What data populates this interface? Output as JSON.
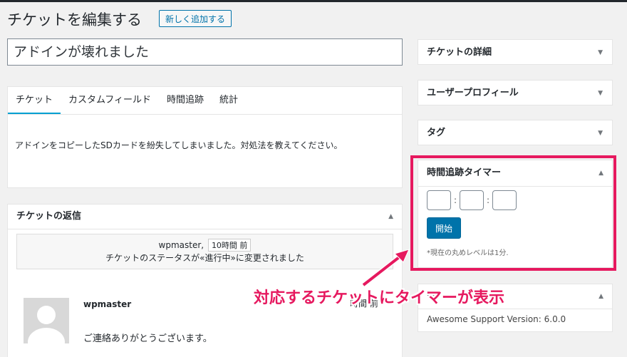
{
  "header": {
    "title": "チケットを編集する",
    "add_new_label": "新しく追加する"
  },
  "ticket": {
    "title_value": "アドインが壊れました"
  },
  "tabs": [
    {
      "label": "チケット",
      "active": true
    },
    {
      "label": "カスタムフィールド"
    },
    {
      "label": "時間追跡"
    },
    {
      "label": "統計"
    }
  ],
  "tab_content": {
    "text": "アドインをコピーしたSDカードを紛失してしまいました。対処法を教えてください。"
  },
  "replies": {
    "title": "チケットの返信",
    "activity": {
      "user": "wpmaster,",
      "time": "10時間 前",
      "message": "チケットのステータスが«進行中»に変更されました"
    },
    "reply": {
      "author": "wpmaster",
      "time_fragment": "時間 前",
      "text": "ご連絡ありがとうございます。"
    }
  },
  "sidebar": {
    "details_title": "チケットの詳細",
    "user_profile_title": "ユーザープロフィール",
    "tags_title": "タグ",
    "timer": {
      "title": "時間追跡タイマー",
      "start_label": "開始",
      "note": "*現在の丸めレベルは1分."
    },
    "info": {
      "title": "ー",
      "version": "Awesome Support Version: 6.0.0"
    }
  },
  "annotation": {
    "text": "対応するチケットにタイマーが表示",
    "color": "#e6195f"
  },
  "icons": {
    "collapse": "▼",
    "expand": "▲"
  },
  "colors": {
    "accent": "#0073aa",
    "highlight": "#e6195f"
  }
}
